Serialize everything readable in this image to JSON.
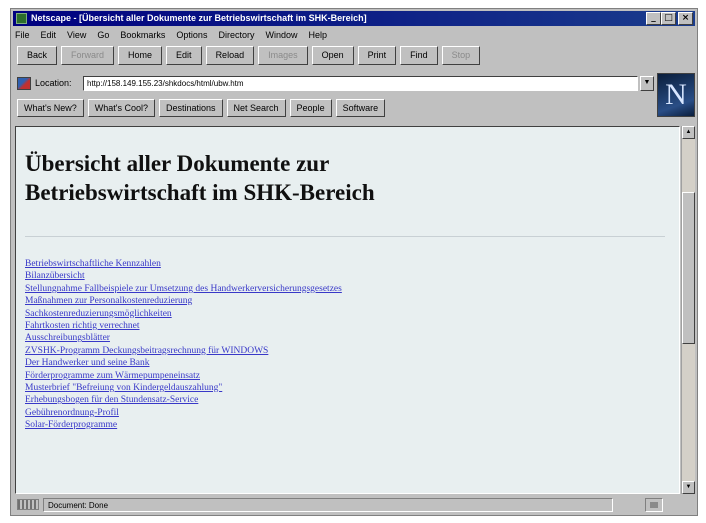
{
  "window": {
    "title": "Netscape - [Übersicht aller Dokumente zur Betriebswirtschaft im SHK-Bereich]",
    "controls": {
      "minimize": "_",
      "maximize": "□",
      "close": "×"
    }
  },
  "menu": {
    "items": [
      "File",
      "Edit",
      "View",
      "Go",
      "Bookmarks",
      "Options",
      "Directory",
      "Window",
      "Help"
    ]
  },
  "toolbar": {
    "buttons": [
      {
        "label": "Back",
        "enabled": true
      },
      {
        "label": "Forward",
        "enabled": false
      },
      {
        "label": "Home",
        "enabled": true
      },
      {
        "label": "Edit",
        "enabled": true
      },
      {
        "label": "Reload",
        "enabled": true
      },
      {
        "label": "Images",
        "enabled": false
      },
      {
        "label": "Open",
        "enabled": true
      },
      {
        "label": "Print",
        "enabled": true
      },
      {
        "label": "Find",
        "enabled": true
      },
      {
        "label": "Stop",
        "enabled": false
      }
    ]
  },
  "location": {
    "label": "Location:",
    "url": "http://158.149.155.23/shkdocs/html/ubw.htm"
  },
  "directory_buttons": [
    "What's New?",
    "What's Cool?",
    "Destinations",
    "Net Search",
    "People",
    "Software"
  ],
  "page": {
    "title_line1": "Übersicht aller Dokumente zur",
    "title_line2": "Betriebswirtschaft im SHK-Bereich",
    "links": [
      "Betriebswirtschaftliche Kennzahlen",
      "Bilanzübersicht",
      "Stellungnahme Fallbeispiele zur Umsetzung des Handwerkerversicherungsgesetzes",
      "Maßnahmen zur Personalkostenreduzierung",
      "Sachkostenreduzierungsmöglichkeiten",
      "Fahrtkosten richtig verrechnet",
      "Ausschreibungsblätter",
      "ZVSHK-Programm Deckungsbeitragsrechnung für WINDOWS",
      "Der Handwerker und seine Bank",
      "Förderprogramme zum Wärmepumpeneinsatz",
      "Musterbrief \"Befreiung von Kindergeldauszahlung\"",
      "Erhebungsbogen für den Stundensatz-Service",
      "Gebührenordnung-Profil",
      "Solar-Förderprogramme"
    ]
  },
  "status": {
    "text": "Document: Done"
  },
  "colors": {
    "title_bar": "#000080",
    "link": "#3838c8",
    "content_bg": "#e8eff0",
    "chrome": "#c0c0c0"
  }
}
